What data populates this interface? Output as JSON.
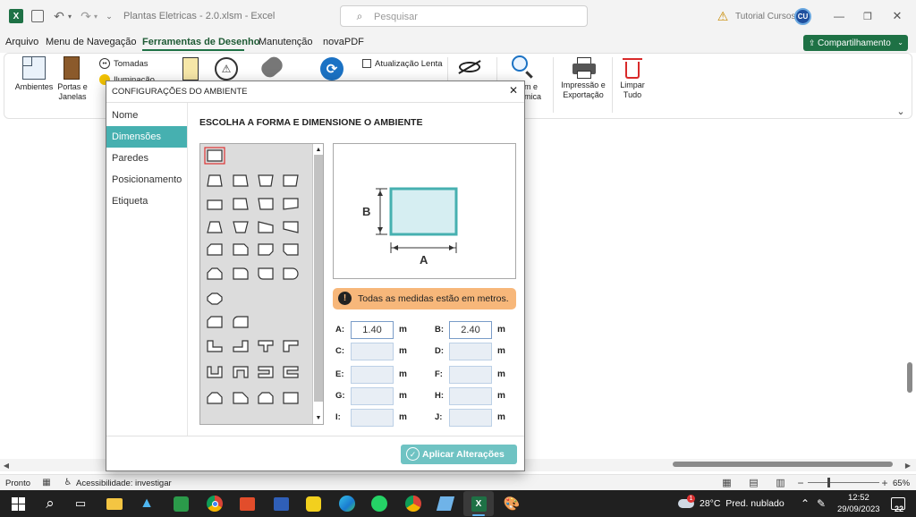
{
  "window": {
    "title": "Plantas Eletricas - 2.0.xlsm  -  Excel",
    "search_placeholder": "Pesquisar",
    "user": "Tutorial Cursos"
  },
  "menu": {
    "items": [
      "Arquivo",
      "Menu de Navegação",
      "Ferramentas de Desenho",
      "Manutenção",
      "novaPDF"
    ],
    "active": "Ferramentas de Desenho",
    "share_label": "Compartilhamento"
  },
  "ribbon": {
    "ambientes": "Ambientes",
    "portas": "Portas e\nJanelas",
    "tomadas": "Tomadas",
    "iluminacao": "Iluminação",
    "atualizacao": "Atualização Lenta",
    "zoom_partial": "m e\nmica",
    "impressao": "Impressão e\nExportação",
    "limpar": "Limpar\nTudo"
  },
  "dialog": {
    "title": "CONFIGURAÇÕES DO AMBIENTE",
    "nav": [
      "Nome",
      "Dimensões",
      "Paredes",
      "Posicionamento",
      "Etiqueta"
    ],
    "nav_active": "Dimensões",
    "heading": "ESCOLHA A FORMA E DIMENSIONE O AMBIENTE",
    "preview": {
      "label_a": "A",
      "label_b": "B"
    },
    "notice": "Todas as medidas estão em metros.",
    "fields": [
      {
        "label": "A:",
        "value": "1.40",
        "unit": "m"
      },
      {
        "label": "B:",
        "value": "2.40",
        "unit": "m"
      },
      {
        "label": "C:",
        "value": "",
        "unit": "m"
      },
      {
        "label": "D:",
        "value": "",
        "unit": "m"
      },
      {
        "label": "E:",
        "value": "",
        "unit": "m"
      },
      {
        "label": "F:",
        "value": "",
        "unit": "m"
      },
      {
        "label": "G:",
        "value": "",
        "unit": "m"
      },
      {
        "label": "H:",
        "value": "",
        "unit": "m"
      },
      {
        "label": "I:",
        "value": "",
        "unit": "m"
      },
      {
        "label": "J:",
        "value": "",
        "unit": "m"
      }
    ],
    "apply_label": "Aplicar Alterações"
  },
  "status": {
    "ready": "Pronto",
    "accessibility": "Acessibilidade: investigar",
    "zoom": "65%"
  },
  "taskbar": {
    "weather": "28°C  Pred. nublado",
    "time": "12:52",
    "date": "29/09/2023",
    "notif": "22"
  },
  "colors": {
    "excel_green": "#1e7145",
    "accent_teal": "#46b0b0",
    "notice": "#f7b77a"
  }
}
